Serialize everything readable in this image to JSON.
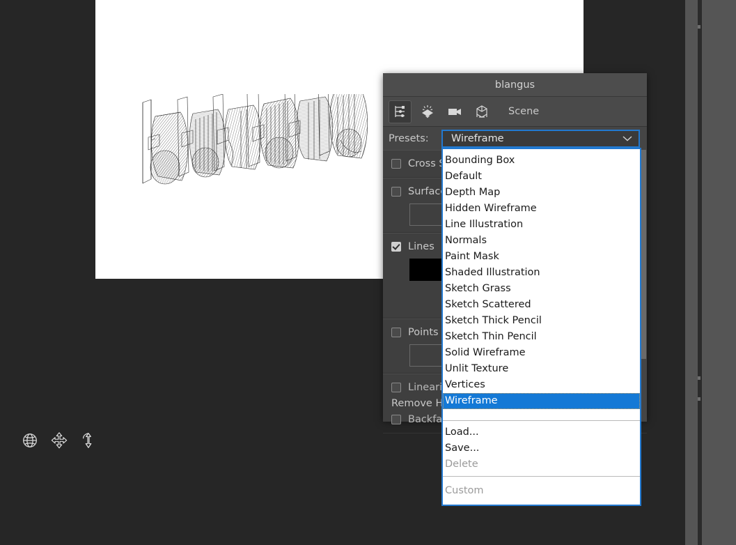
{
  "window": {
    "title": "blangus"
  },
  "tabbar": {
    "icons": [
      {
        "name": "settings-sliders-icon",
        "active": true
      },
      {
        "name": "lighting-icon",
        "active": false
      },
      {
        "name": "camera-icon",
        "active": false
      },
      {
        "name": "object-orientation-icon",
        "active": false
      }
    ],
    "scene_label": "Scene"
  },
  "presets": {
    "label": "Presets:",
    "selected": "Wireframe",
    "chevron": "chevron-down-icon",
    "options": [
      "Bounding Box",
      "Default",
      "Depth Map",
      "Hidden Wireframe",
      "Line Illustration",
      "Normals",
      "Paint Mask",
      "Shaded Illustration",
      "Sketch Grass",
      "Sketch Scattered",
      "Sketch Thick Pencil",
      "Sketch Thin Pencil",
      "Solid Wireframe",
      "Unlit Texture",
      "Vertices",
      "Wireframe"
    ],
    "actions": [
      {
        "label": "Load...",
        "disabled": false
      },
      {
        "label": "Save...",
        "disabled": false
      },
      {
        "label": "Delete",
        "disabled": true
      }
    ],
    "footer": {
      "label": "Custom",
      "disabled": true
    }
  },
  "panel_properties": [
    {
      "name": "cross-section",
      "label": "Cross S",
      "checked": false,
      "swatch": null
    },
    {
      "name": "surface",
      "label": "Surface",
      "checked": false,
      "swatch": "#3f3f3f"
    },
    {
      "name": "lines",
      "label": "Lines",
      "checked": true,
      "swatch": "#000000"
    },
    {
      "name": "points",
      "label": "Points",
      "checked": false,
      "swatch": "#3f3f3f"
    },
    {
      "name": "linearize",
      "label": "Lineariz",
      "checked": false,
      "swatch": null
    },
    {
      "name": "remove-hidden",
      "label": "Remove Hi",
      "checked": null,
      "swatch": null
    },
    {
      "name": "backface",
      "label": "Backfac",
      "checked": false,
      "swatch": null
    }
  ],
  "nav_gizmos": [
    {
      "name": "orbit-globe-icon"
    },
    {
      "name": "pan-move-icon"
    },
    {
      "name": "zoom-vertical-icon"
    }
  ],
  "colors": {
    "app_background": "#262626",
    "canvas": "#ffffff",
    "panel_background": "#3f3f3f",
    "panel_titlebar": "#4d4d4d",
    "accent_blue": "#2279d0",
    "selection_blue": "#1479d6",
    "dock": "#555555",
    "scrollbar_thumb": "#6b6b6b"
  }
}
